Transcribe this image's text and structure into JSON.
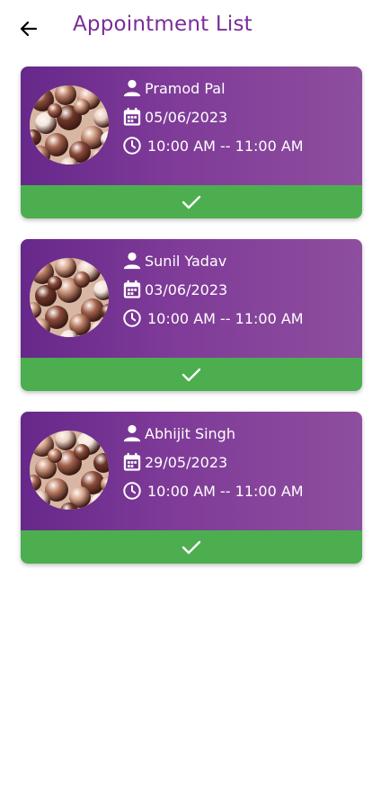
{
  "header": {
    "title": "Appointment List",
    "back_icon": "arrow-left-icon"
  },
  "colors": {
    "title": "#7b2d98",
    "card_gradient_start": "#66288a",
    "card_gradient_end": "#8e4e9e",
    "confirm_bar": "#4cae4f",
    "text": "#ffffff"
  },
  "appointments": [
    {
      "name": "Pramod Pal",
      "date": "05/06/2023",
      "time": "10:00 AM -- 11:00 AM",
      "action_icon": "check-icon"
    },
    {
      "name": "Sunil Yadav",
      "date": "03/06/2023",
      "time": "10:00 AM -- 11:00 AM",
      "action_icon": "check-icon"
    },
    {
      "name": "Abhijit Singh",
      "date": "29/05/2023",
      "time": "10:00 AM -- 11:00 AM",
      "action_icon": "check-icon"
    }
  ]
}
